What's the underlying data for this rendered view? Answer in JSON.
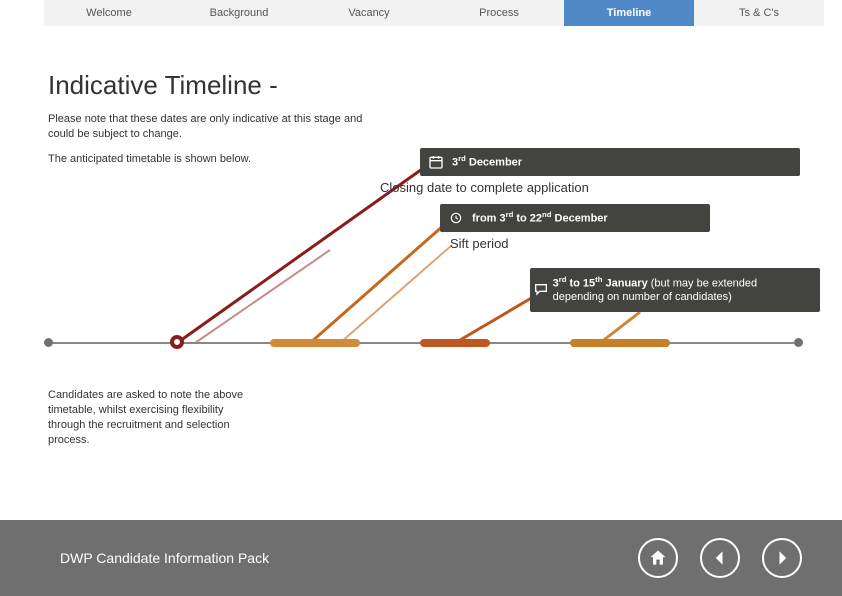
{
  "tabs": {
    "items": [
      {
        "label": "Welcome"
      },
      {
        "label": "Background"
      },
      {
        "label": "Vacancy"
      },
      {
        "label": "Process"
      },
      {
        "label": "Timeline"
      },
      {
        "label": "Ts & C's"
      }
    ],
    "active_index": 4
  },
  "heading": "Indicative Timeline -",
  "intro": {
    "p1": "Please note that these dates are only indicative at this stage and could be subject to change.",
    "p2": "The anticipated timetable is shown below."
  },
  "events": {
    "e1_date_html": "3<sup>rd</sup> December",
    "e1_label": "Closing date to complete application",
    "e2_date_html": "from 3<sup>rd</sup> to 22<sup>nd</sup> December",
    "e2_label": "Sift period",
    "e3_date_html": "3<sup>rd</sup> to 15<sup>th</sup> January <span style='font-weight:normal'>(but may be extended depending on number of candidates)</span>"
  },
  "note": "Candidates are asked to note the above timetable, whilst exercising flexibility through the recruitment and selection process.",
  "footer": {
    "title": "DWP Candidate Information Pack"
  },
  "colors": {
    "tab_active": "#4e88c7",
    "box_bg": "#43443f",
    "line_red": "#8a1c1c",
    "line_orange": "#c46a1f",
    "line_tan": "#c9873a"
  }
}
